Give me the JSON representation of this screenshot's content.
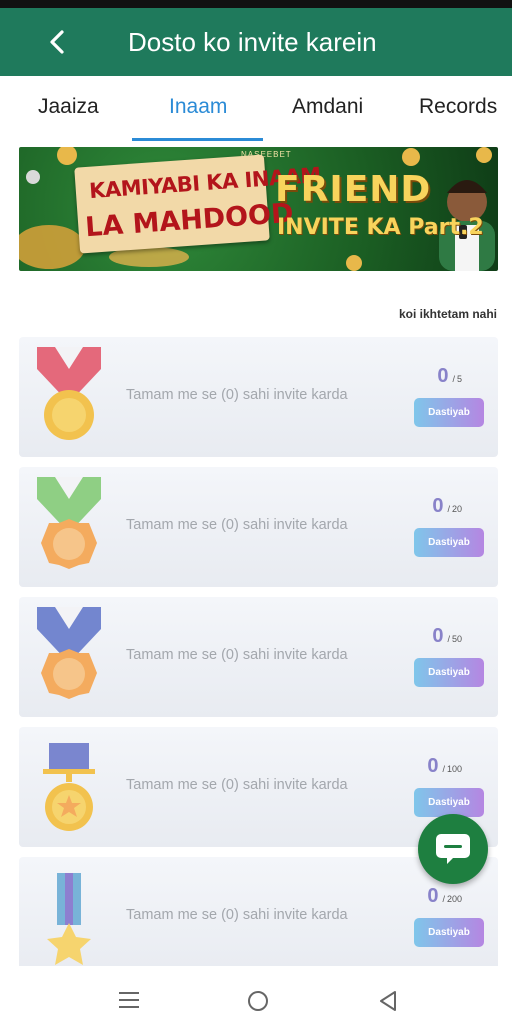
{
  "header": {
    "title": "Dosto ko invite karein",
    "back_icon": "chevron-left-icon",
    "background_color": "#1f7a5c"
  },
  "tabs": [
    {
      "label": "Jaaiza",
      "active": false
    },
    {
      "label": "Inaam",
      "active": true
    },
    {
      "label": "Amdani",
      "active": false
    },
    {
      "label": "Records",
      "active": false
    }
  ],
  "banner": {
    "brand": "NASEEBET",
    "line1": "KAMIYABI KA INAAM",
    "line2": "LA MAHDOOD",
    "line3": "FRIEND",
    "line4": "INVITE KA Part.2"
  },
  "criteria_text": "koi ikhtetam nahi",
  "rewards": [
    {
      "description": "Tamam me se (0) sahi invite karda",
      "count": "0",
      "target": "5",
      "button": "Dastiyab",
      "medal_icon": "medal-red-icon"
    },
    {
      "description": "Tamam me se (0) sahi invite karda",
      "count": "0",
      "target": "20",
      "button": "Dastiyab",
      "medal_icon": "medal-green-icon"
    },
    {
      "description": "Tamam me se (0) sahi invite karda",
      "count": "0",
      "target": "50",
      "button": "Dastiyab",
      "medal_icon": "medal-blue-icon"
    },
    {
      "description": "Tamam me se (0) sahi invite karda",
      "count": "0",
      "target": "100",
      "button": "Dastiyab",
      "medal_icon": "medal-star-icon"
    },
    {
      "description": "Tamam me se (0) sahi invite karda",
      "count": "0",
      "target": "200",
      "button": "Dastiyab",
      "medal_icon": "medal-gold-star-icon"
    }
  ],
  "chat_icon": "chat-bubble-icon",
  "nav": {
    "menu_icon": "menu-icon",
    "home_icon": "home-circle-icon",
    "back_icon": "back-triangle-icon"
  },
  "colors": {
    "accent": "#2b8bd6",
    "fab": "#1e7f40"
  }
}
